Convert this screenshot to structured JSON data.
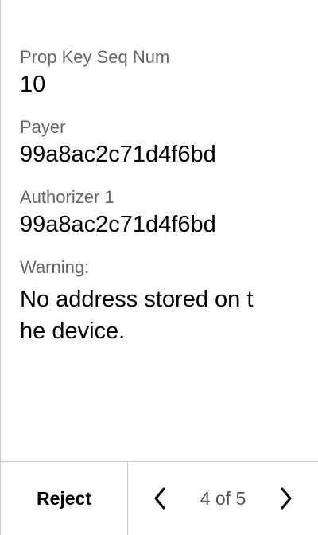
{
  "fields": [
    {
      "label": "Prop Key Seq Num",
      "value": "10"
    },
    {
      "label": "Payer",
      "value": "99a8ac2c71d4f6bd"
    },
    {
      "label": "Authorizer 1",
      "value": "99a8ac2c71d4f6bd"
    }
  ],
  "warning": {
    "label": "Warning:",
    "text": "No address stored on t\nhe device."
  },
  "footer": {
    "reject_label": "Reject",
    "page_indicator": "4 of 5",
    "prev_icon": "chevron-left-icon",
    "next_icon": "chevron-right-icon"
  },
  "colors": {
    "label": "#666666",
    "value": "#000000",
    "divider": "#c8c8c8"
  }
}
